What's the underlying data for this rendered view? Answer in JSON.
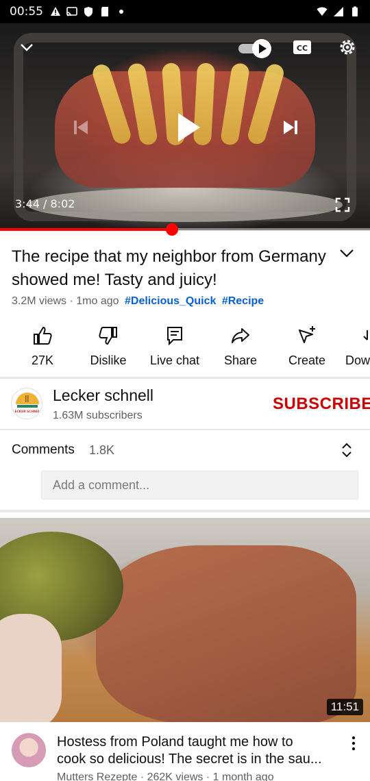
{
  "status_bar": {
    "time": "00:55",
    "icons": [
      "alert-icon",
      "cast-icon",
      "shield-icon",
      "sd-card-icon",
      "dot-icon",
      "wifi-icon",
      "signal-icon",
      "battery-icon"
    ]
  },
  "player": {
    "current_time": "3:44",
    "separator": " / ",
    "total_time": "8:02",
    "progress_fraction": 0.465,
    "autoplay_on": true
  },
  "video": {
    "title": "The recipe that my neighbor from Germany showed me! Tasty and juicy!",
    "views": "3.2M views",
    "age": "1mo ago",
    "tags": [
      "#Delicious_Quick",
      "#Recipe"
    ]
  },
  "actions": [
    {
      "label": "27K",
      "icon": "thumbs-up-icon"
    },
    {
      "label": "Dislike",
      "icon": "thumbs-down-icon"
    },
    {
      "label": "Live chat",
      "icon": "chat-icon"
    },
    {
      "label": "Share",
      "icon": "share-icon"
    },
    {
      "label": "Create",
      "icon": "create-icon"
    },
    {
      "label": "Dow",
      "icon": "download-icon"
    }
  ],
  "channel": {
    "name": "Lecker schnell",
    "subscribers": "1.63M subscribers",
    "subscribe_label": "SUBSCRIBE",
    "logo_text": "LECKER SCHNELL"
  },
  "comments": {
    "label": "Comments",
    "count": "1.8K",
    "placeholder": "Add a comment..."
  },
  "recommended": {
    "duration": "11:51",
    "title_line1": "Hostess from Poland taught me how to",
    "title_line2": "cook so delicious! The secret is in the sau...",
    "meta": "Mutters Rezepte · 262K views · 1 month ago"
  },
  "colors": {
    "accent_red": "#ff0000",
    "subscribe_red": "#cc0000",
    "link_blue": "#065fd4"
  }
}
